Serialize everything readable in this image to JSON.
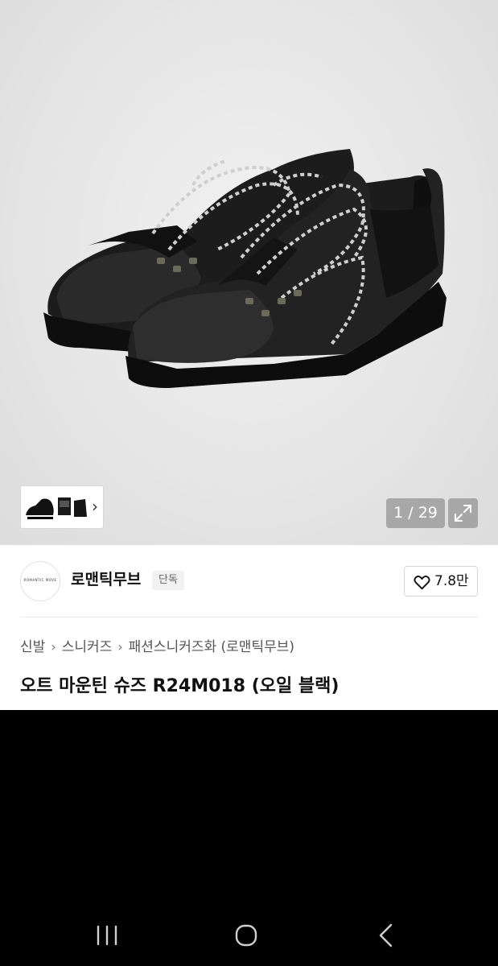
{
  "gallery": {
    "page_counter": "1 / 29",
    "thumbnail_icon": "chevron-right-icon",
    "expand_icon": "expand-icon",
    "image_alt": "black leather mountain shoes with black and white rope laces"
  },
  "brand": {
    "logo_text": "ROMANTIC MOVE",
    "name": "로맨틱무브",
    "badge": "단독",
    "like_icon": "heart-icon",
    "like_count": "7.8만"
  },
  "breadcrumb": {
    "items": [
      "신발",
      "스니커즈",
      "패션스니커즈화 (로맨틱무브)"
    ],
    "separator_icon": "chevron-right-icon"
  },
  "product": {
    "title": "오트 마운틴 슈즈 R24M018 (오일 블랙)"
  },
  "navbar": {
    "recents_icon": "recents-icon",
    "home_icon": "home-icon",
    "back_icon": "back-icon"
  },
  "colors": {
    "image_background": "#e6e6e6",
    "panel_background": "#ffffff",
    "screen_background": "#000000",
    "counter_badge": "#8a8a8a"
  }
}
